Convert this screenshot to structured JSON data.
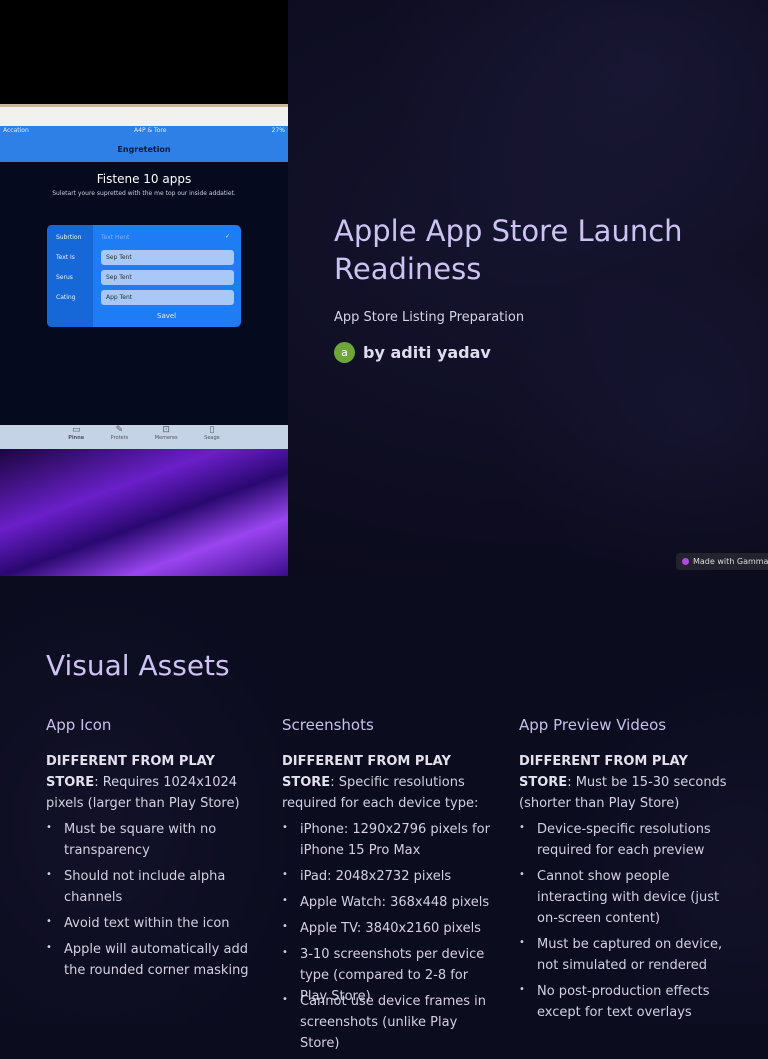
{
  "hero": {
    "title": "Apple App Store Launch Readiness",
    "subtitle": "App Store Listing Preparation",
    "author": {
      "avatar_letter": "a",
      "name": "by aditi yadav"
    },
    "badge": "Made with Gamma"
  },
  "photo": {
    "status_left": "Accation",
    "status_center": "A4P & Tore",
    "status_right": "27%",
    "nav_title": "Engretetion",
    "screen_title": "Fistene 10 apps",
    "screen_subtitle": "Suletart youre supretted with the me top our inside addatiet.",
    "form": [
      {
        "label": "Subrtion",
        "value": "Text Hent"
      },
      {
        "label": "Text Is",
        "value": "Sep Tent"
      },
      {
        "label": "Serus",
        "value": "Sep Tent"
      },
      {
        "label": "Cating",
        "value": "App Tent"
      }
    ],
    "save": "Savel",
    "tabs": [
      "Pinne",
      "Protets",
      "Memeres",
      "Seage"
    ]
  },
  "section": {
    "title": "Visual Assets",
    "columns": [
      {
        "heading": "App Icon",
        "lead_bold": "DIFFERENT FROM PLAY STORE",
        "lead_text": ": Requires 1024x1024 pixels (larger than Play Store)",
        "items": [
          "Must be square with no transparency",
          "Should not include alpha channels",
          "Avoid text within the icon",
          "Apple will automatically add the rounded corner masking"
        ]
      },
      {
        "heading": "Screenshots",
        "lead_bold": "DIFFERENT FROM PLAY STORE",
        "lead_text": ": Specific resolutions required for each device type:",
        "items": [
          "iPhone: 1290x2796 pixels for iPhone 15 Pro Max",
          "iPad: 2048x2732 pixels",
          "Apple Watch: 368x448 pixels",
          "Apple TV: 3840x2160 pixels",
          "3-10 screenshots per device type (compared to 2-8 for Play Store)",
          "Cannot use device frames in screenshots (unlike Play Store)"
        ]
      },
      {
        "heading": "App Preview Videos",
        "lead_bold": "DIFFERENT FROM PLAY STORE",
        "lead_text": ": Must be 15-30 seconds (shorter than Play Store)",
        "items": [
          "Device-specific resolutions required for each preview",
          "Cannot show people interacting with device (just on-screen content)",
          "Must be captured on device, not simulated or rendered",
          "No post-production effects except for text overlays"
        ]
      }
    ]
  }
}
